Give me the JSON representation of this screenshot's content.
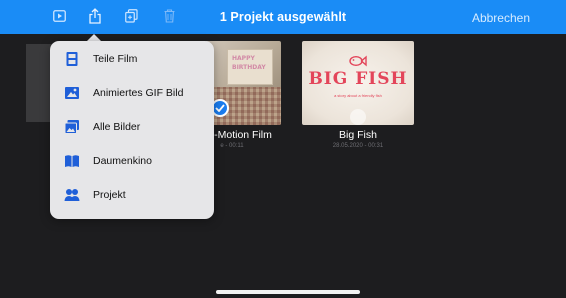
{
  "topbar": {
    "title": "1 Projekt ausgewählt",
    "cancel_label": "Abbrechen",
    "accent_color": "#1a8cf6",
    "icons": [
      "play-icon",
      "share-icon",
      "duplicate-icon",
      "trash-icon"
    ]
  },
  "projects": [
    {
      "name": "-Motion Film",
      "meta": "e - 00:11",
      "selected": true,
      "thumb_text_line1": "HAPPY",
      "thumb_text_line2": "BIRTHDAY"
    },
    {
      "name": "Big Fish",
      "meta": "28.05.2020 - 00:31",
      "selected": false,
      "thumb_title": "BIG FISH",
      "thumb_subtitle": "a story about a friendly fish"
    }
  ],
  "share_menu": {
    "items": [
      {
        "label": "Teile Film",
        "icon": "film-icon"
      },
      {
        "label": "Animiertes GIF Bild",
        "icon": "image-icon"
      },
      {
        "label": "Alle Bilder",
        "icon": "photos-icon"
      },
      {
        "label": "Daumenkino",
        "icon": "book-icon"
      },
      {
        "label": "Projekt",
        "icon": "people-icon"
      }
    ],
    "icon_color": "#1f5fd8"
  }
}
